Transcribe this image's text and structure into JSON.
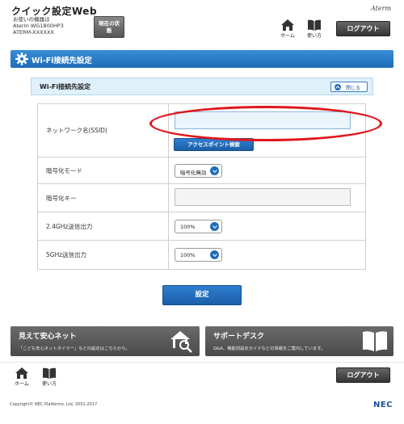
{
  "header": {
    "app_title": "クイック設定Web",
    "device_label": "お使いの機器は",
    "device_model": "Aterm WG1800HP3",
    "device_id": "ATERM-XXXXXX",
    "status_button": "現在の状態",
    "brand": "Aterm",
    "home_label": "ホーム",
    "help_label": "使い方",
    "logout_label": "ログアウト"
  },
  "page": {
    "title": "Wi-Fi接続先設定",
    "panel_title": "Wi-Fi接続先設定",
    "close_label": "閉じる"
  },
  "form": {
    "ssid_label": "ネットワーク名(SSID)",
    "ssid_value": "",
    "ap_search_label": "アクセスポイント検索",
    "encryption_mode_label": "暗号化モード",
    "encryption_mode_value": "暗号化無効",
    "encryption_key_label": "暗号化キー",
    "encryption_key_value": "",
    "tx_power_24_label": "2.4GHz送信出力",
    "tx_power_24_value": "100%",
    "tx_power_5_label": "5GHz送信出力",
    "tx_power_5_value": "100%",
    "submit_label": "設定"
  },
  "promos": {
    "safe_net_title": "見えて安心ネット",
    "safe_net_desc": "「こども安心ネットタイマー」などの設定はこちらから。",
    "support_title": "サポートデスク",
    "support_desc": "Q&A、機能別設定ガイドなどの情報をご案内しています。"
  },
  "footer": {
    "home_label": "ホーム",
    "help_label": "使い方",
    "logout_label": "ログアウト",
    "copyright": "Copyright© NEC Platforms, Ltd. 2001-2017",
    "logo": "NEC"
  },
  "colors": {
    "accent": "#1e6cb8",
    "highlight": "#e0161c",
    "dark_button": "#444444"
  }
}
